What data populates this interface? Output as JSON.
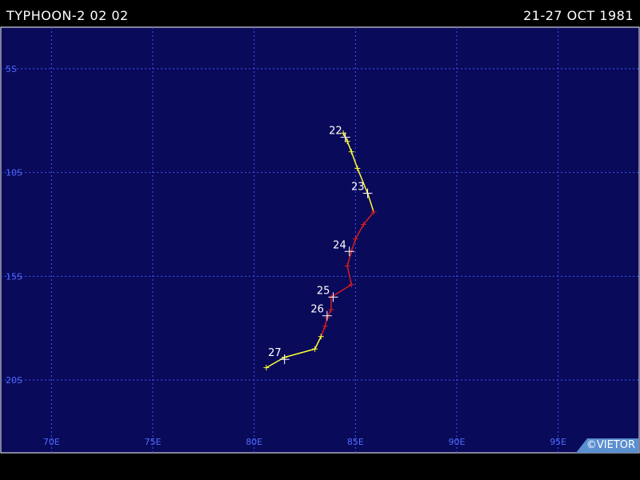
{
  "header": {
    "storm_name": "TYPHOON-2 02 02",
    "date_range": "21-27 OCT 1981"
  },
  "credit": "©VIETOR",
  "colors": {
    "map_background": "#0a0a5a",
    "grid": "#3a55ff",
    "axis_label": "#4f6bff",
    "track_weak": "#ffff33",
    "track_typhoon": "#d41e1e",
    "day_label": "#ffffff",
    "credit_box": "#5a8fd0"
  },
  "map": {
    "lon_range": [
      67.5,
      99
    ],
    "lat_range": [
      -23.5,
      -3
    ],
    "lon_gridlines": [
      70,
      75,
      80,
      85,
      90,
      95
    ],
    "lat_gridlines": [
      -5,
      -10,
      -15,
      -20
    ],
    "lon_labels": [
      "70E",
      "75E",
      "80E",
      "85E",
      "90E",
      "95E"
    ],
    "lat_labels": [
      "5S",
      "10S",
      "15S",
      "20S"
    ]
  },
  "track": {
    "points": [
      {
        "lon": 84.4,
        "lat": -8.1,
        "cat": "weak"
      },
      {
        "lon": 84.6,
        "lat": -8.5,
        "cat": "weak"
      },
      {
        "lon": 84.8,
        "lat": -9.0,
        "cat": "weak"
      },
      {
        "lon": 85.1,
        "lat": -9.8,
        "cat": "weak"
      },
      {
        "lon": 85.6,
        "lat": -11.0,
        "cat": "weak"
      },
      {
        "lon": 85.9,
        "lat": -11.9,
        "cat": "typhoon"
      },
      {
        "lon": 85.4,
        "lat": -12.5,
        "cat": "typhoon"
      },
      {
        "lon": 85.0,
        "lat": -13.2,
        "cat": "typhoon"
      },
      {
        "lon": 84.8,
        "lat": -13.8,
        "cat": "typhoon"
      },
      {
        "lon": 84.6,
        "lat": -14.5,
        "cat": "typhoon"
      },
      {
        "lon": 84.8,
        "lat": -15.4,
        "cat": "typhoon"
      },
      {
        "lon": 83.8,
        "lat": -16.0,
        "cat": "typhoon"
      },
      {
        "lon": 83.8,
        "lat": -16.6,
        "cat": "typhoon"
      },
      {
        "lon": 83.6,
        "lat": -17.0,
        "cat": "typhoon"
      },
      {
        "lon": 83.5,
        "lat": -17.4,
        "cat": "typhoon"
      },
      {
        "lon": 83.3,
        "lat": -17.9,
        "cat": "weak"
      },
      {
        "lon": 83.0,
        "lat": -18.5,
        "cat": "weak"
      },
      {
        "lon": 81.5,
        "lat": -18.9,
        "cat": "weak"
      },
      {
        "lon": 80.6,
        "lat": -19.4,
        "cat": "weak"
      }
    ],
    "day_markers": [
      {
        "label": "22",
        "lon": 84.5,
        "lat": -8.3
      },
      {
        "label": "23",
        "lon": 85.6,
        "lat": -11.0
      },
      {
        "label": "24",
        "lon": 84.7,
        "lat": -13.8
      },
      {
        "label": "25",
        "lon": 83.9,
        "lat": -16.0
      },
      {
        "label": "26",
        "lon": 83.6,
        "lat": -16.9
      },
      {
        "label": "27",
        "lon": 81.5,
        "lat": -19.0
      }
    ]
  }
}
